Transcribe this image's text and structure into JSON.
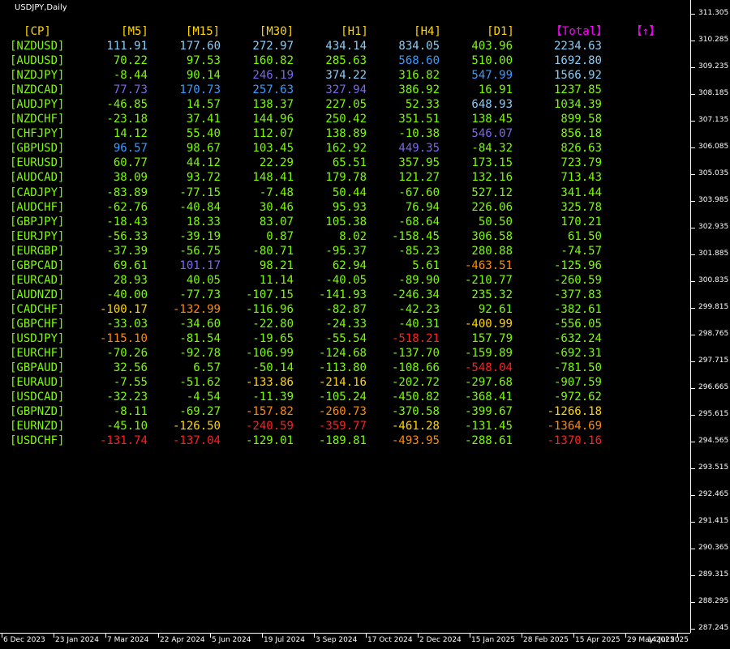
{
  "window": {
    "title": "USDJPY,Daily"
  },
  "colors": {
    "name": "#7CFC00",
    "header_tf": "#FFD700",
    "header_total": "#FF00FF",
    "header_arrow": "#FF00FF",
    "skyblue": "#87CEFA",
    "dodgerblue": "#3A9BFF",
    "slateblue": "#7B68EE",
    "green": "#7CFC00",
    "gold": "#FFD700",
    "orange": "#FF8C00",
    "red": "#FF2020"
  },
  "table": {
    "headers": {
      "cp": "[CP]",
      "m5": "[M5]",
      "m15": "[M15]",
      "m30": "[M30]",
      "h1": "[H1]",
      "h4": "[H4]",
      "d1": "[D1]",
      "total": "【Total】",
      "arrow": "【↑】"
    },
    "rows": [
      {
        "name": "[NZDUSD]",
        "v": [
          "111.91",
          "177.60",
          "272.97",
          "434.14",
          "834.05",
          "403.96",
          "2234.63"
        ],
        "c": [
          "skyblue",
          "skyblue",
          "skyblue",
          "skyblue",
          "skyblue",
          "green",
          "skyblue"
        ]
      },
      {
        "name": "[AUDUSD]",
        "v": [
          "70.22",
          "97.53",
          "160.82",
          "285.63",
          "568.60",
          "510.00",
          "1692.80"
        ],
        "c": [
          "green",
          "green",
          "green",
          "green",
          "dodgerblue",
          "green",
          "skyblue"
        ]
      },
      {
        "name": "[NZDJPY]",
        "v": [
          "-8.44",
          "90.14",
          "246.19",
          "374.22",
          "316.82",
          "547.99",
          "1566.92"
        ],
        "c": [
          "green",
          "green",
          "slateblue",
          "skyblue",
          "green",
          "dodgerblue",
          "skyblue"
        ]
      },
      {
        "name": "[NZDCAD]",
        "v": [
          "77.73",
          "170.73",
          "257.63",
          "327.94",
          "386.92",
          "16.91",
          "1237.85"
        ],
        "c": [
          "slateblue",
          "dodgerblue",
          "dodgerblue",
          "slateblue",
          "green",
          "green",
          "green"
        ]
      },
      {
        "name": "[AUDJPY]",
        "v": [
          "-46.85",
          "14.57",
          "138.37",
          "227.05",
          "52.33",
          "648.93",
          "1034.39"
        ],
        "c": [
          "green",
          "green",
          "green",
          "green",
          "green",
          "skyblue",
          "green"
        ]
      },
      {
        "name": "[NZDCHF]",
        "v": [
          "-23.18",
          "37.41",
          "144.96",
          "250.42",
          "351.51",
          "138.45",
          "899.58"
        ],
        "c": [
          "green",
          "green",
          "green",
          "green",
          "green",
          "green",
          "green"
        ]
      },
      {
        "name": "[CHFJPY]",
        "v": [
          "14.12",
          "55.40",
          "112.07",
          "138.89",
          "-10.38",
          "546.07",
          "856.18"
        ],
        "c": [
          "green",
          "green",
          "green",
          "green",
          "green",
          "slateblue",
          "green"
        ]
      },
      {
        "name": "[GBPUSD]",
        "v": [
          "96.57",
          "98.67",
          "103.45",
          "162.92",
          "449.35",
          "-84.32",
          "826.63"
        ],
        "c": [
          "dodgerblue",
          "green",
          "green",
          "green",
          "slateblue",
          "green",
          "green"
        ]
      },
      {
        "name": "[EURUSD]",
        "v": [
          "60.77",
          "44.12",
          "22.29",
          "65.51",
          "357.95",
          "173.15",
          "723.79"
        ],
        "c": [
          "green",
          "green",
          "green",
          "green",
          "green",
          "green",
          "green"
        ]
      },
      {
        "name": "[AUDCAD]",
        "v": [
          "38.09",
          "93.72",
          "148.41",
          "179.78",
          "121.27",
          "132.16",
          "713.43"
        ],
        "c": [
          "green",
          "green",
          "green",
          "green",
          "green",
          "green",
          "green"
        ]
      },
      {
        "name": "[CADJPY]",
        "v": [
          "-83.89",
          "-77.15",
          "-7.48",
          "50.44",
          "-67.60",
          "527.12",
          "341.44"
        ],
        "c": [
          "green",
          "green",
          "green",
          "green",
          "green",
          "green",
          "green"
        ]
      },
      {
        "name": "[AUDCHF]",
        "v": [
          "-62.76",
          "-40.84",
          "30.46",
          "95.93",
          "76.94",
          "226.06",
          "325.78"
        ],
        "c": [
          "green",
          "green",
          "green",
          "green",
          "green",
          "green",
          "green"
        ]
      },
      {
        "name": "[GBPJPY]",
        "v": [
          "-18.43",
          "18.33",
          "83.07",
          "105.38",
          "-68.64",
          "50.50",
          "170.21"
        ],
        "c": [
          "green",
          "green",
          "green",
          "green",
          "green",
          "green",
          "green"
        ]
      },
      {
        "name": "[EURJPY]",
        "v": [
          "-56.33",
          "-39.19",
          "0.87",
          "8.02",
          "-158.45",
          "306.58",
          "61.50"
        ],
        "c": [
          "green",
          "green",
          "green",
          "green",
          "green",
          "green",
          "green"
        ]
      },
      {
        "name": "[EURGBP]",
        "v": [
          "-37.39",
          "-56.75",
          "-80.71",
          "-95.37",
          "-85.23",
          "280.88",
          "-74.57"
        ],
        "c": [
          "green",
          "green",
          "green",
          "green",
          "green",
          "green",
          "green"
        ]
      },
      {
        "name": "[GBPCAD]",
        "v": [
          "69.61",
          "101.17",
          "98.21",
          "62.94",
          "5.61",
          "-463.51",
          "-125.96"
        ],
        "c": [
          "green",
          "slateblue",
          "green",
          "green",
          "green",
          "orange",
          "green"
        ]
      },
      {
        "name": "[EURCAD]",
        "v": [
          "28.93",
          "40.05",
          "11.14",
          "-40.05",
          "-89.90",
          "-210.77",
          "-260.59"
        ],
        "c": [
          "green",
          "green",
          "green",
          "green",
          "green",
          "green",
          "green"
        ]
      },
      {
        "name": "[AUDNZD]",
        "v": [
          "-40.00",
          "-77.73",
          "-107.15",
          "-141.93",
          "-246.34",
          "235.32",
          "-377.83"
        ],
        "c": [
          "green",
          "green",
          "green",
          "green",
          "green",
          "green",
          "green"
        ]
      },
      {
        "name": "[CADCHF]",
        "v": [
          "-100.17",
          "-132.99",
          "-116.96",
          "-82.87",
          "-42.23",
          "92.61",
          "-382.61"
        ],
        "c": [
          "gold",
          "orange",
          "green",
          "green",
          "green",
          "green",
          "green"
        ]
      },
      {
        "name": "[GBPCHF]",
        "v": [
          "-33.03",
          "-34.60",
          "-22.80",
          "-24.33",
          "-40.31",
          "-400.99",
          "-556.05"
        ],
        "c": [
          "green",
          "green",
          "green",
          "green",
          "green",
          "gold",
          "green"
        ]
      },
      {
        "name": "[USDJPY]",
        "v": [
          "-115.10",
          "-81.54",
          "-19.65",
          "-55.54",
          "-518.21",
          "157.79",
          "-632.24"
        ],
        "c": [
          "orange",
          "green",
          "green",
          "green",
          "red",
          "green",
          "green"
        ]
      },
      {
        "name": "[EURCHF]",
        "v": [
          "-70.26",
          "-92.78",
          "-106.99",
          "-124.68",
          "-137.70",
          "-159.89",
          "-692.31"
        ],
        "c": [
          "green",
          "green",
          "green",
          "green",
          "green",
          "green",
          "green"
        ]
      },
      {
        "name": "[GBPAUD]",
        "v": [
          "32.56",
          "6.57",
          "-50.14",
          "-113.80",
          "-108.66",
          "-548.04",
          "-781.50"
        ],
        "c": [
          "green",
          "green",
          "green",
          "green",
          "green",
          "red",
          "green"
        ]
      },
      {
        "name": "[EURAUD]",
        "v": [
          "-7.55",
          "-51.62",
          "-133.86",
          "-214.16",
          "-202.72",
          "-297.68",
          "-907.59"
        ],
        "c": [
          "green",
          "green",
          "gold",
          "gold",
          "green",
          "green",
          "green"
        ]
      },
      {
        "name": "[USDCAD]",
        "v": [
          "-32.23",
          "-4.54",
          "-11.39",
          "-105.24",
          "-450.82",
          "-368.41",
          "-972.62"
        ],
        "c": [
          "green",
          "green",
          "green",
          "green",
          "green",
          "green",
          "green"
        ]
      },
      {
        "name": "[GBPNZD]",
        "v": [
          "-8.11",
          "-69.27",
          "-157.82",
          "-260.73",
          "-370.58",
          "-399.67",
          "-1266.18"
        ],
        "c": [
          "green",
          "green",
          "orange",
          "orange",
          "green",
          "green",
          "gold"
        ]
      },
      {
        "name": "[EURNZD]",
        "v": [
          "-45.10",
          "-126.50",
          "-240.59",
          "-359.77",
          "-461.28",
          "-131.45",
          "-1364.69"
        ],
        "c": [
          "green",
          "gold",
          "red",
          "red",
          "gold",
          "green",
          "orange"
        ]
      },
      {
        "name": "[USDCHF]",
        "v": [
          "-131.74",
          "-137.04",
          "-129.01",
          "-189.81",
          "-493.95",
          "-288.61",
          "-1370.16"
        ],
        "c": [
          "red",
          "red",
          "green",
          "green",
          "orange",
          "green",
          "red"
        ]
      }
    ]
  },
  "price_axis": {
    "labels": [
      "311.305",
      "310.285",
      "309.235",
      "308.185",
      "307.135",
      "306.085",
      "305.035",
      "303.985",
      "302.935",
      "301.885",
      "300.835",
      "299.815",
      "298.765",
      "297.715",
      "296.665",
      "295.615",
      "294.565",
      "293.515",
      "292.465",
      "291.415",
      "290.365",
      "289.315",
      "288.295",
      "287.245"
    ]
  },
  "time_axis": {
    "labels": [
      "6 Dec 2023",
      "23 Jan 2024",
      "7 Mar 2024",
      "22 Apr 2024",
      "5 Jun 2024",
      "19 Jul 2024",
      "3 Sep 2024",
      "17 Oct 2024",
      "2 Dec 2024",
      "15 Jan 2025",
      "28 Feb 2025",
      "15 Apr 2025",
      "29 May 2025",
      "14 Jul 2025"
    ]
  }
}
